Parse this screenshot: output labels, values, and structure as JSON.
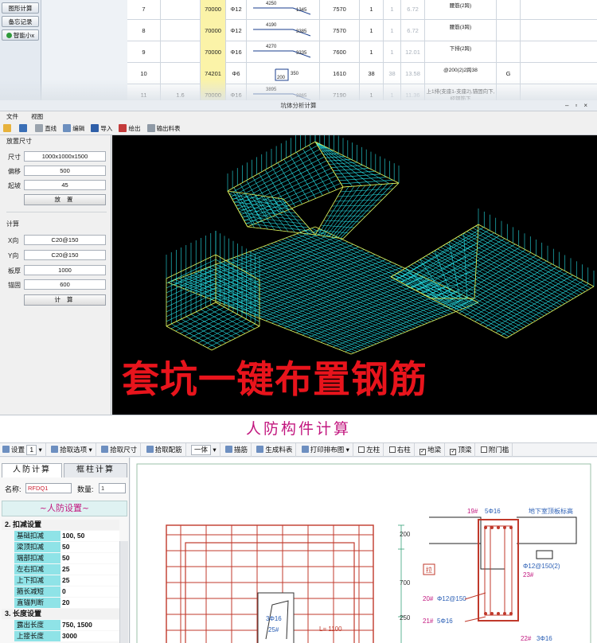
{
  "panel1": {
    "side_buttons": [
      "图形计算",
      "备忘记录",
      "智能小x"
    ],
    "rows": [
      {
        "no": "7",
        "d": "",
        "len": "70000",
        "dia": "Φ12",
        "shape_top": "4250",
        "shape_side": "1345",
        "a": "7570",
        "b": "1",
        "c": "1",
        "d2": "6.72",
        "desc": "腰筋(2跨)",
        "f": ""
      },
      {
        "no": "8",
        "d": "",
        "len": "70000",
        "dia": "Φ12",
        "shape_top": "4190",
        "shape_side": "3385",
        "a": "7570",
        "b": "1",
        "c": "1",
        "d2": "6.72",
        "desc": "腰筋(3跨)",
        "f": ""
      },
      {
        "no": "9",
        "d": "",
        "len": "70000",
        "dia": "Φ16",
        "shape_top": "4270",
        "shape_side": "3335",
        "a": "7600",
        "b": "1",
        "c": "1",
        "d2": "12.01",
        "desc": "下排(2跨)",
        "f": ""
      },
      {
        "no": "10",
        "d": "",
        "len": "74201",
        "dia": "Φ6",
        "shape_top": "350",
        "shape_side": "200",
        "a": "1610",
        "b": "38",
        "c": "38",
        "d2": "13.58",
        "desc": "@200(2)2跨38",
        "f": "G"
      },
      {
        "no": "11",
        "d": "1.6",
        "len": "70000",
        "dia": "Φ16",
        "shape_top": "3895",
        "shape_side": "2865",
        "a": "7190",
        "b": "1",
        "c": "1",
        "d2": "11.36",
        "desc": "上1排(支座1-支座2),锚固向下,经钢筋下",
        "f": ""
      }
    ]
  },
  "panel2": {
    "title": "坑体分析计算",
    "menu": [
      "文件",
      "视图"
    ],
    "toolbar": [
      "直线",
      "编辑",
      "导入",
      "绘出",
      "输出料表"
    ],
    "placement_title": "放置尺寸",
    "fields_place": [
      {
        "label": "尺寸",
        "value": "1000x1000x1500"
      },
      {
        "label": "偏移",
        "value": "500"
      },
      {
        "label": "起坡",
        "value": "45"
      }
    ],
    "place_button": "放 置",
    "calc_title": "计算",
    "fields_calc": [
      {
        "label": "X向",
        "value": "C20@150"
      },
      {
        "label": "Y向",
        "value": "C20@150"
      },
      {
        "label": "板厚",
        "value": "1000"
      },
      {
        "label": "锚固",
        "value": "600"
      }
    ],
    "calc_button": "计 算",
    "banner": "套坑一键布置钢筋",
    "colors": {
      "mesh": "#26e0e6",
      "edge": "#e5e84a",
      "banner": "#e8141c"
    }
  },
  "panel3": {
    "title": "人防构件计算",
    "toolbar": {
      "settings": "设置",
      "count": "1",
      "pick_options": "拾取选项",
      "pick_size": "拾取尺寸",
      "pick_rebar": "拾取配筋",
      "mode": "一体",
      "draw_rebar": "描筋",
      "gen_table": "生成料表",
      "print": "打印排布图",
      "checks": [
        {
          "label": "左柱",
          "checked": ""
        },
        {
          "label": "右柱",
          "checked": ""
        },
        {
          "label": "地梁",
          "checked": "✓"
        },
        {
          "label": "顶梁",
          "checked": "✓"
        },
        {
          "label": "附门槛",
          "checked": ""
        }
      ]
    },
    "tabs": [
      "人防计算",
      "框柱计算"
    ],
    "name_label": "名称:",
    "name_value": "RFDQ1",
    "qty_label": "数量:",
    "qty_value": "1",
    "setting_title": "~人防设置~",
    "groups": [
      {
        "title": "2. 扣减设置",
        "rows": [
          {
            "k": "基础扣减",
            "v": "100, 50"
          },
          {
            "k": "梁顶扣减",
            "v": "50"
          },
          {
            "k": "端部扣减",
            "v": "50"
          },
          {
            "k": "左右扣减",
            "v": "25"
          },
          {
            "k": "上下扣减",
            "v": "25"
          },
          {
            "k": "箍长减短",
            "v": "0"
          },
          {
            "k": "直锚判断",
            "v": "20"
          }
        ]
      },
      {
        "title": "3. 长度设置",
        "rows": [
          {
            "k": "露出长度",
            "v": "750, 1500"
          },
          {
            "k": "上接长度",
            "v": "3000"
          }
        ]
      }
    ],
    "drawing": {
      "left_labels": {
        "bar": "3Φ16",
        "mark": "25#",
        "length": "L= 1100"
      },
      "right_labels": {
        "top_note": "地下室顶板标高",
        "r19": "19#",
        "r19v": "5Φ16",
        "dim200": "200",
        "dim700": "700",
        "dim250": "250",
        "lbl_la": "拉",
        "r20": "20#",
        "r20v": "Φ12@150",
        "r21": "21#",
        "r21v": "5Φ16",
        "r22": "22#",
        "r22v": "3Φ16",
        "stirrup": "Φ12@150(2)",
        "r23": "23#"
      }
    }
  }
}
